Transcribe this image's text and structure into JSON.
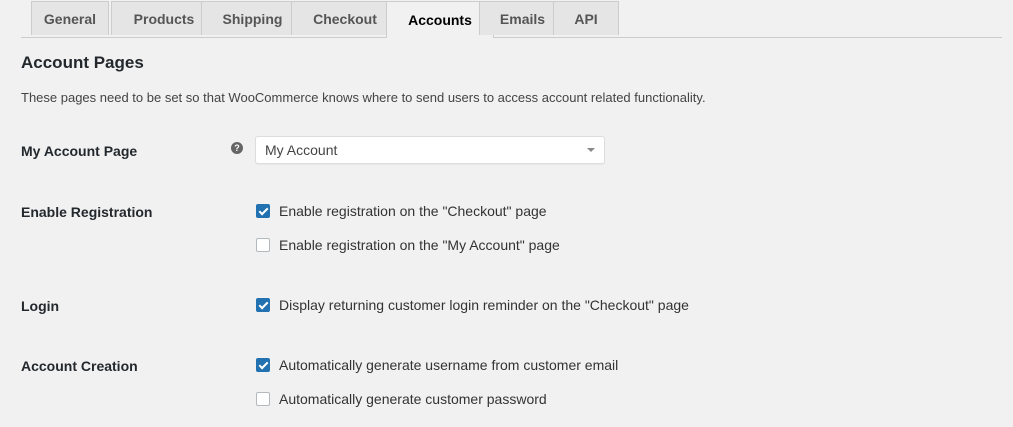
{
  "tabs": [
    {
      "label": "General",
      "active": false
    },
    {
      "label": "Products",
      "active": false
    },
    {
      "label": "Shipping",
      "active": false
    },
    {
      "label": "Checkout",
      "active": false
    },
    {
      "label": "Accounts",
      "active": true
    },
    {
      "label": "Emails",
      "active": false
    },
    {
      "label": "API",
      "active": false
    }
  ],
  "section": {
    "title": "Account Pages",
    "description": "These pages need to be set so that WooCommerce knows where to send users to access account related functionality."
  },
  "my_account_page": {
    "label": "My Account Page",
    "help_icon": "question-circle-icon",
    "help_glyph": "?",
    "selected": "My Account"
  },
  "enable_registration": {
    "label": "Enable Registration",
    "options": [
      {
        "label": "Enable registration on the \"Checkout\" page",
        "checked": true
      },
      {
        "label": "Enable registration on the \"My Account\" page",
        "checked": false
      }
    ]
  },
  "login": {
    "label": "Login",
    "options": [
      {
        "label": "Display returning customer login reminder on the \"Checkout\" page",
        "checked": true
      }
    ]
  },
  "account_creation": {
    "label": "Account Creation",
    "options": [
      {
        "label": "Automatically generate username from customer email",
        "checked": true
      },
      {
        "label": "Automatically generate customer password",
        "checked": false
      }
    ]
  },
  "colors": {
    "background": "#f1f1f1",
    "checkbox_checked": "#2271b1",
    "tab_inactive": "#e5e5e5"
  }
}
